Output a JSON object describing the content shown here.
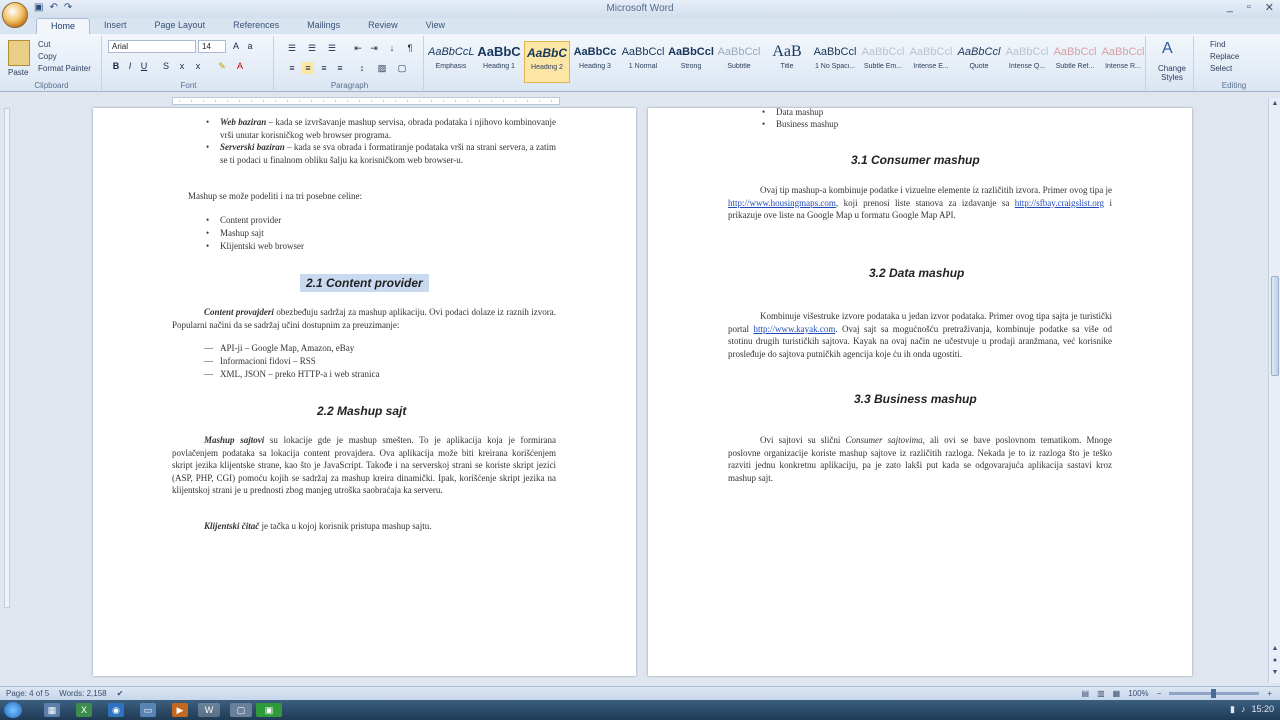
{
  "window": {
    "title": "Microsoft Word",
    "qat": [
      "save-icon",
      "undo-icon",
      "redo-icon"
    ],
    "controls": [
      "_",
      "▫",
      "✕"
    ]
  },
  "ribbon_tabs": [
    "Home",
    "Insert",
    "Page Layout",
    "References",
    "Mailings",
    "Review",
    "View"
  ],
  "ribbon": {
    "clipboard": {
      "paste": "Paste",
      "cut": "Cut",
      "copy": "Copy",
      "format_painter": "Format Painter",
      "label": "Clipboard"
    },
    "font": {
      "name": "Arial",
      "size": "14",
      "label": "Font"
    },
    "paragraph": {
      "label": "Paragraph"
    },
    "styles": [
      {
        "sample": "AaBbCcL",
        "name": "Emphasis"
      },
      {
        "sample": "AaBbC",
        "name": "Heading 1"
      },
      {
        "sample": "AaBbC",
        "name": "Heading 2"
      },
      {
        "sample": "AaBbCc",
        "name": "Heading 3"
      },
      {
        "sample": "AaBbCcl",
        "name": "1 Normal"
      },
      {
        "sample": "AaBbCcl",
        "name": "Strong"
      },
      {
        "sample": "AaBbCcl",
        "name": "Subtitle"
      },
      {
        "sample": "AaB",
        "name": "Title"
      },
      {
        "sample": "AaBbCcl",
        "name": "1 No Spaci..."
      },
      {
        "sample": "AaBbCcl",
        "name": "Subtle Em..."
      },
      {
        "sample": "AaBbCcl",
        "name": "Intense E..."
      },
      {
        "sample": "AaBbCcl",
        "name": "Quote"
      },
      {
        "sample": "AaBbCcl",
        "name": "Intense Q..."
      },
      {
        "sample": "AaBbCcl",
        "name": "Subtle Ref..."
      },
      {
        "sample": "AaBbCcl",
        "name": "Intense R..."
      }
    ],
    "change_styles": "Change Styles",
    "editing": {
      "find": "Find",
      "replace": "Replace",
      "select": "Select",
      "label": "Editing"
    }
  },
  "left_page": {
    "b1_bold": "Web baziran",
    "b1_rest": " – kada se izvršavanje mashup servisa, obrada podataka i njihovo kombinovanje vrši unutar korisničkog web browser programa.",
    "b2_bold": "Serverski baziran",
    "b2_rest": " – kada se sva obrada i formatiranje podataka vrši na strani servera, a zatim se ti podaci u finalnom obliku šalju ka korisničkom web browser-u.",
    "intro": "Mashup se može podeliti i na tri posebne celine:",
    "parts": [
      "Content provider",
      "Mashup sajt",
      "Klijentski web browser"
    ],
    "h21": "2.1 Content provider",
    "p21_bold": "Content provajderi",
    "p21_rest": " obezbeđuju sadržaj za mashup aplikaciju. Ovi podaci dolaze iz raznih izvora. Popularni načini da se sadržaj učini dostupnim za preuzimanje:",
    "sources": [
      "API-ji – Google Map, Amazon, eBay",
      "Informacioni fidovi – RSS",
      "XML, JSON – preko HTTP-a i web stranica"
    ],
    "h22": "2.2 Mashup sajt",
    "p22_bold": "Mashup sajtovi",
    "p22_rest": " su lokacije gde je mashup smešten. To je aplikacija koja je formirana povlačenjem podataka sa lokacija content provajdera. Ova aplikacija može biti kreirana korišćenjem skript jezika klijentske strane, kao što je JavaScript. Takođe i na serverskoj strani se koriste skript jezici (ASP, PHP, CGI) pomoću kojih se sadržaj za mashup kreira dinamički. Ipak, korišćenje skript jezika na klijentskoj strani je u prednosti zbog manjeg utroška saobraćaja ka serveru.",
    "p23_bold": "Klijentski čitač",
    "p23_rest": " je tačka u kojoj korisnik pristupa mashup sajtu."
  },
  "right_page": {
    "top_items": [
      "Data mashup",
      "Business mashup"
    ],
    "h31": "3.1 Consumer mashup",
    "p31": "Ovaj tip mashup-a kombinuje podatke i vizuelne elemente iz različitih izvora. Primer ovog tipa je",
    "p31_link1": "http://www.housingmaps.com",
    "p31_mid": ", koji prenosi liste stanova za izdavanje sa",
    "p31_link2": "http://sfbay.craigslist.org",
    "p31_end": " i prikazuje ove liste na Google Map u formatu Google Map API.",
    "h32": "3.2 Data mashup",
    "p32": "Kombinuje višestruke izvore podataka u jedan izvor podataka. Primer ovog tipa sajta je turistički portal",
    "p32_link": "http://www.kayak.com",
    "p32_rest": ". Ovaj sajt sa mogućnošću pretraživanja, kombinuje podatke sa više od stotinu drugih turističkih sajtova. Kayak na ovaj način ne učestvuje u prodaji aranžmana, već korisnike prosleđuje do sajtova putničkih agencija koje ću ih onda ugostiti.",
    "h33": "3.3 Business mashup",
    "p33_a": "Ovi sajtovi su slični",
    "p33_it": "Consumer sajtovima",
    "p33_b": ", ali ovi se bave poslovnom tematikom. Mnoge poslovne organizacije koriste mashup sajtove iz različitih razloga. Nekada je to iz razloga što je teško razviti jednu konkretnu aplikaciju, pa je zato lakši put kada se odgovarajuća aplikacija sastavi kroz mashup sajt."
  },
  "status": {
    "page": "Page: 4 of 5",
    "words": "Words: 2,158",
    "zoom": "100%"
  },
  "taskbar": {
    "clock": "15:20"
  },
  "colors": {
    "accent": "#1e3a68",
    "highlight": "#c9daf0",
    "link": "#1f4bb8"
  }
}
